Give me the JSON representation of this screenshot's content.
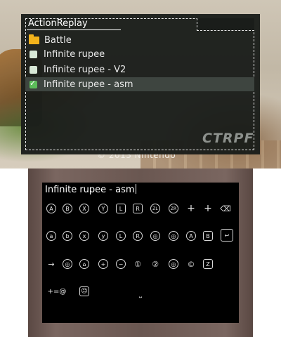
{
  "top_screen": {
    "game_copyright": "© 2013 Nintendo",
    "menu": {
      "title": "ActionReplay",
      "items": [
        {
          "label": "Battle",
          "type": "folder"
        },
        {
          "label": "Infinite rupee",
          "type": "cheat",
          "checked": false
        },
        {
          "label": "Infinite rupee - V2",
          "type": "cheat",
          "checked": false
        },
        {
          "label": "Infinite rupee - asm",
          "type": "cheat",
          "checked": true,
          "selected": true
        }
      ],
      "logo": "CTRPF",
      "checkmark": "✓"
    }
  },
  "bottom_screen": {
    "input_value": "Infinite rupee - asm",
    "keyboard": {
      "row1": [
        "A",
        "B",
        "X",
        "Y",
        "L",
        "R",
        "ZL",
        "ZR",
        "+",
        "+",
        "⌫"
      ],
      "row2": [
        "a",
        "b",
        "x",
        "y",
        "L",
        "R",
        "◎",
        "◎",
        "A",
        "B",
        "↩"
      ],
      "row3": [
        "→",
        "◎",
        "⌂",
        "+",
        "−",
        "①",
        "②",
        "◎",
        "©",
        "Z"
      ],
      "row4": [
        "+=@",
        "☺",
        "˽"
      ]
    }
  }
}
